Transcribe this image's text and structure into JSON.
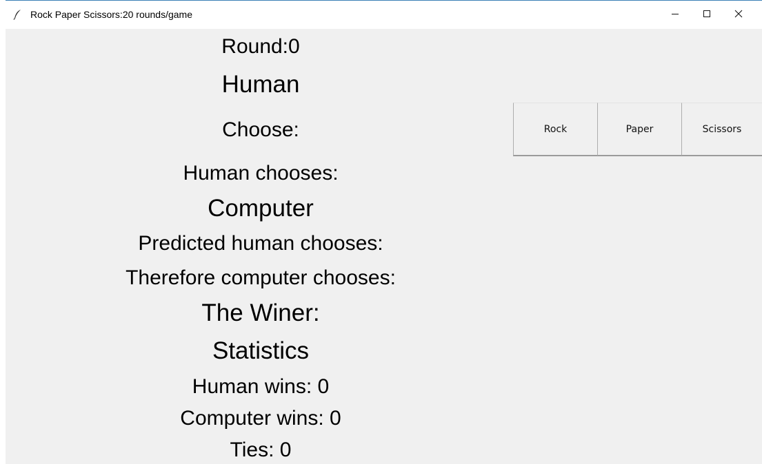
{
  "window": {
    "title": "Rock Paper Scissors:20 rounds/game",
    "app_icon": "feather-icon",
    "controls": {
      "minimize": "minimize-icon",
      "maximize": "maximize-icon",
      "close": "close-icon"
    }
  },
  "game": {
    "round": "Round:0",
    "human_heading": "Human",
    "choose": "Choose:",
    "human_chooses": "Human chooses:",
    "computer_heading": "Computer",
    "predicted": "Predicted human chooses:",
    "therefore": "Therefore computer chooses:",
    "winner": "The Winer:",
    "statistics_heading": "Statistics",
    "human_wins": "Human wins: 0",
    "computer_wins": "Computer wins: 0",
    "ties": "Ties: 0"
  },
  "buttons": {
    "rock": "Rock",
    "paper": "Paper",
    "scissors": "Scissors"
  },
  "colors": {
    "window_bg": "#f0f0f0",
    "titlebar_bg": "#ffffff",
    "titlebar_accent": "#3a7fb5"
  }
}
